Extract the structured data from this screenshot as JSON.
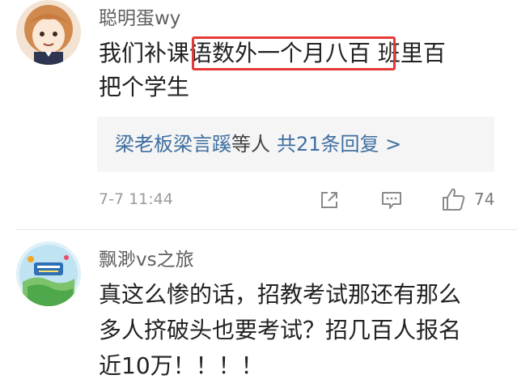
{
  "comments": [
    {
      "username": "聪明蛋wy",
      "text_prefix": "我们补课",
      "text_highlight": "语数外一个月八百",
      "text_suffix": " 班里百",
      "text_line2": "把个学生",
      "reply_preview": {
        "names": "梁老板梁言蹊",
        "connector": "等人",
        "count_label": "共21条回复 >"
      },
      "time": "7-7 11:44",
      "likes": "74"
    },
    {
      "username": "飘渺vs之旅",
      "lines": [
        "真这么惨的话，招教考试那还有那么",
        "多人挤破头也要考试？招几百人报名",
        "近10万！！！！"
      ]
    }
  ],
  "icons": {
    "share": "share-out-icon",
    "comment": "comment-bubble-icon",
    "like": "thumbs-up-icon"
  },
  "colors": {
    "highlight_border": "#e53935",
    "link_blue": "#3e6ea0",
    "username_gray": "#5f5f5f",
    "reply_bg": "#f5f5f5"
  }
}
